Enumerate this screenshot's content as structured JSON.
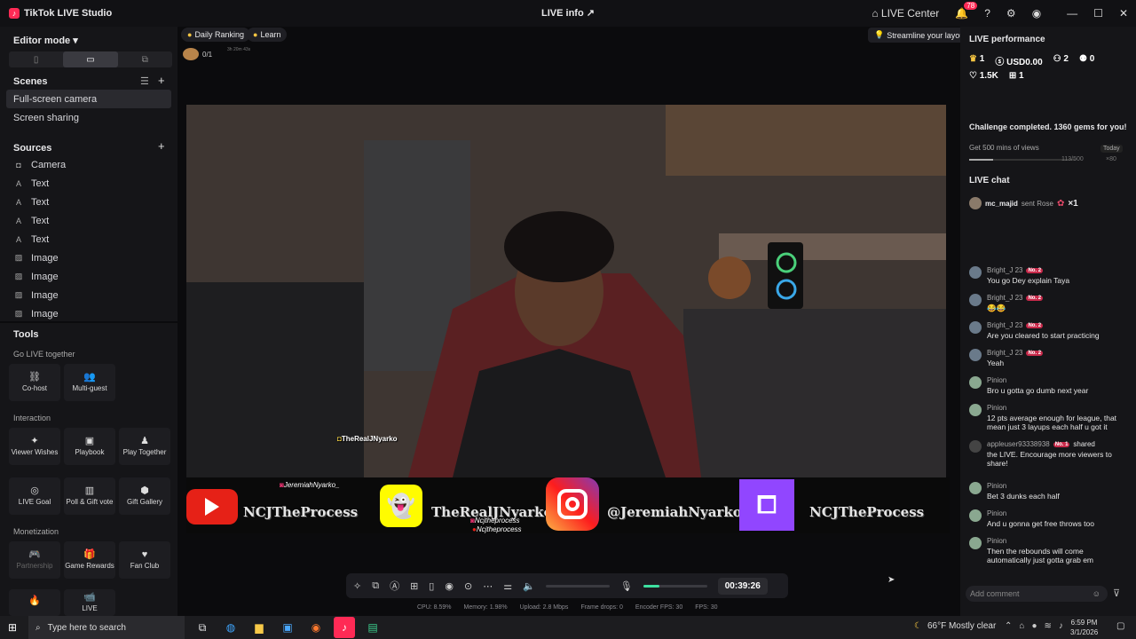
{
  "window": {
    "title": "TikTok LIVE Studio",
    "center_title": "LIVE info",
    "live_center": "LIVE Center",
    "notif_count": "78"
  },
  "left": {
    "editor_mode": "Editor mode",
    "scenes_label": "Scenes",
    "scenes": [
      "Full-screen camera",
      "Screen sharing"
    ],
    "sources_label": "Sources",
    "sources": [
      {
        "icon": "camera-icon",
        "label": "Camera"
      },
      {
        "icon": "text-icon",
        "label": "Text"
      },
      {
        "icon": "text-icon",
        "label": "Text"
      },
      {
        "icon": "text-icon",
        "label": "Text"
      },
      {
        "icon": "text-icon",
        "label": "Text"
      },
      {
        "icon": "image-icon",
        "label": "Image"
      },
      {
        "icon": "image-icon",
        "label": "Image"
      },
      {
        "icon": "image-icon",
        "label": "Image"
      },
      {
        "icon": "image-icon",
        "label": "Image"
      }
    ],
    "tools_label": "Tools",
    "go_live_together": "Go LIVE together",
    "cohost": "Co-host",
    "multiguest": "Multi-guest",
    "interaction": "Interaction",
    "viewer_wishes": "Viewer Wishes",
    "playbook": "Playbook",
    "play_together": "Play Together",
    "live_goal": "LIVE Goal",
    "poll_gift": "Poll & Gift vote",
    "gift_gallery": "Gift Gallery",
    "monetization": "Monetization",
    "partnership": "Partnership",
    "game_rewards": "Game Rewards",
    "fan_club": "Fan Club",
    "live_cut": "LIVE"
  },
  "stage": {
    "daily_ranking": "Daily Ranking",
    "learn": "Learn",
    "rank_value": "0/1",
    "rank_time": "3h 20m 43s",
    "streamline": "Streamline your layout",
    "overlay_handle": "TheRealJNyarko",
    "banner_handle_top": "JeremiahNyarko_",
    "yt_text": "NCJTheProcess",
    "snap_text": "TheRealJNyarko",
    "ig_text": "@JeremiahNyarko_",
    "twitch_text": "NCJTheProcess",
    "small1": "Ncjtheprocess",
    "small2": "Ncjtheprocess",
    "timer": "00:39:26",
    "mic_level": 0.25,
    "stats": {
      "cpu": "CPU: 8.59%",
      "memory": "Memory: 1.98%",
      "upload": "Upload: 2.8 Mbps",
      "frame_drops": "Frame drops: 0",
      "encoder": "Encoder FPS: 30",
      "fps": "FPS: 30"
    }
  },
  "right": {
    "perf_title": "LIVE performance",
    "m1": "1",
    "m2": "USD0.00",
    "m3": "2",
    "m4": "0",
    "m5": "1.5K",
    "m6": "1",
    "challenge": "Challenge completed. 1360 gems for you!",
    "goal_label": "Get 500 mins of views",
    "goal_when": "Today",
    "goal_progress": "113/500",
    "goal_reward": "×80",
    "goal_fraction": 0.226,
    "chat_title": "LIVE chat",
    "gift_user": "mc_majid",
    "gift_action": "sent Rose",
    "gift_count": "×1",
    "messages": [
      {
        "user": "Bright_J 23",
        "rank": "No. 2",
        "text": "You go Dey explain Taya"
      },
      {
        "user": "Bright_J 23",
        "rank": "No. 2",
        "text": "😂😂"
      },
      {
        "user": "Bright_J 23",
        "rank": "No. 2",
        "text": "Are you cleared to start practicing"
      },
      {
        "user": "Bright_J 23",
        "rank": "No. 2",
        "text": "Yeah"
      },
      {
        "user": "Pinion",
        "rank": "",
        "text": "Bro u gotta go dumb next year"
      },
      {
        "user": "Pinion",
        "rank": "",
        "text": "12 pts average enough for league, that mean just 3 layups each half u got it"
      },
      {
        "user": "appleuser93338938",
        "rank": "No. 1",
        "text": "the LIVE. Encourage more viewers to share!",
        "extra": "shared"
      },
      {
        "user": "Pinion",
        "rank": "",
        "text": "Bet 3 dunks each half"
      },
      {
        "user": "Pinion",
        "rank": "",
        "text": "And u gonna get free throws too"
      },
      {
        "user": "Pinion",
        "rank": "",
        "text": "Then the rebounds will come automatically just gotta grab em"
      }
    ],
    "comment_placeholder": "Add comment"
  },
  "taskbar": {
    "search": "Type here to search",
    "weather": "66°F  Mostly clear",
    "time": "6:59 PM",
    "date": "3/1/2026"
  }
}
